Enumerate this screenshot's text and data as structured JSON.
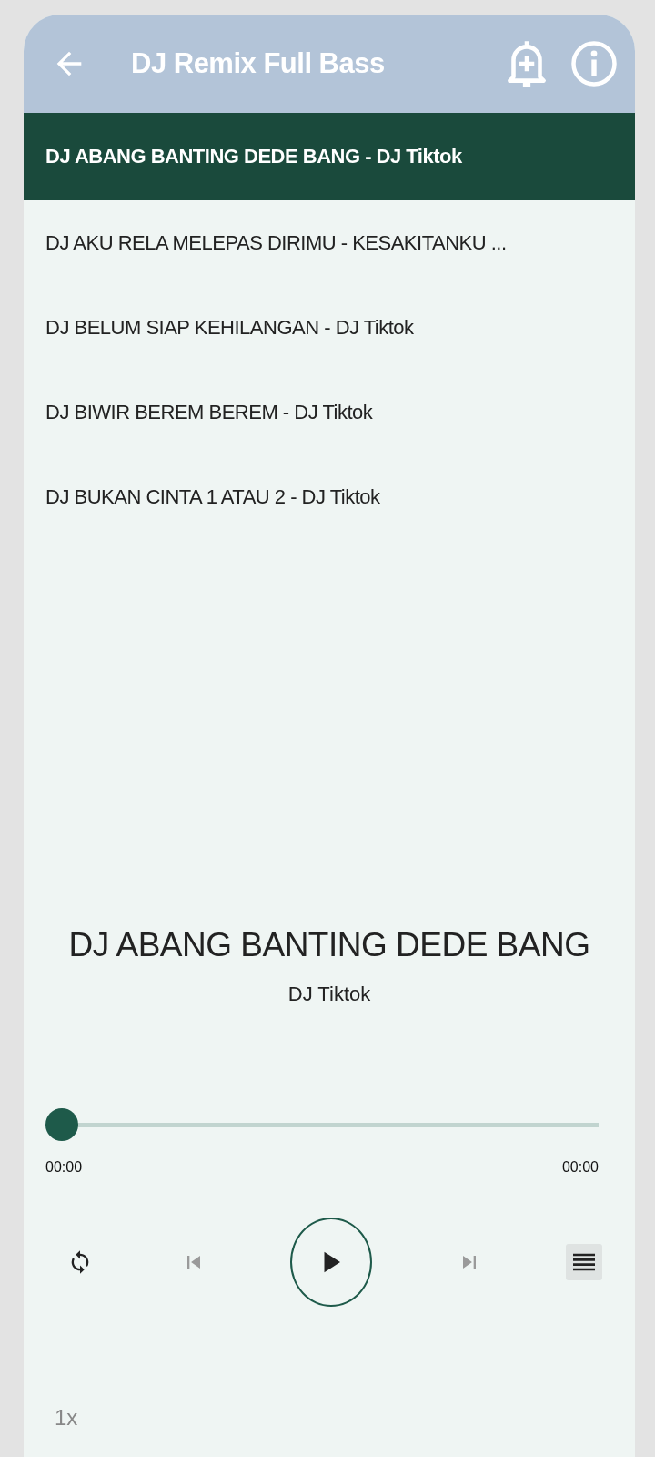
{
  "header": {
    "title": "DJ Remix Full Bass"
  },
  "songs": [
    {
      "label": "DJ ABANG BANTING DEDE BANG - DJ Tiktok",
      "selected": true
    },
    {
      "label": "DJ AKU RELA MELEPAS DIRIMU - KESAKITANKU ...",
      "selected": false
    },
    {
      "label": "DJ BELUM SIAP KEHILANGAN - DJ Tiktok",
      "selected": false
    },
    {
      "label": "DJ BIWIR BEREM BEREM - DJ Tiktok",
      "selected": false
    },
    {
      "label": "DJ BUKAN CINTA 1 ATAU 2 - DJ Tiktok",
      "selected": false
    }
  ],
  "now_playing": {
    "title": "DJ ABANG BANTING DEDE BANG",
    "artist": "DJ Tiktok"
  },
  "progress": {
    "level": 0,
    "elapsed": "00:00",
    "duration": "00:00"
  },
  "controls": [
    {
      "kind": "repeat",
      "disabled": false
    },
    {
      "kind": "previous",
      "disabled": true
    },
    {
      "kind": "play",
      "disabled": false
    },
    {
      "kind": "next",
      "disabled": true
    },
    {
      "kind": "queue",
      "disabled": false
    }
  ],
  "speed": "1x"
}
